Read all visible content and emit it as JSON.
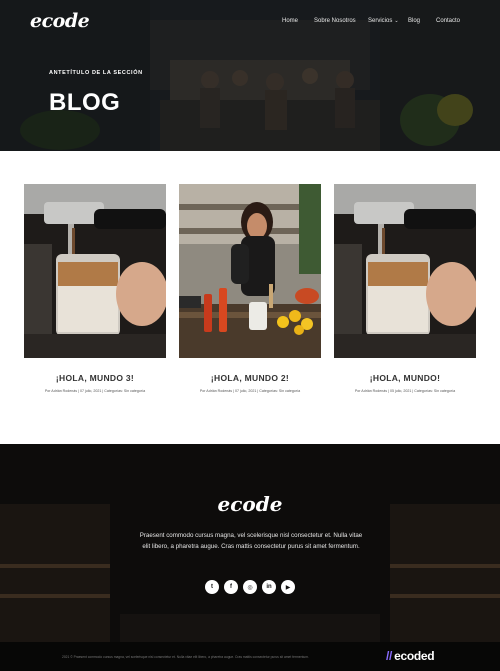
{
  "header": {
    "logo": "ecode",
    "nav": [
      {
        "label": "Home",
        "has_dropdown": false
      },
      {
        "label": "Sobre Nosotros",
        "has_dropdown": false
      },
      {
        "label": "Servicios",
        "has_dropdown": true
      },
      {
        "label": "Blog",
        "has_dropdown": false
      },
      {
        "label": "Contacto",
        "has_dropdown": false
      }
    ]
  },
  "hero": {
    "subtitle": "ANTETÍTULO DE LA SECCIÓN",
    "title": "BLOG"
  },
  "posts": [
    {
      "title": "¡HOLA, MUNDO 3!",
      "meta": "Por Adrián Rodenás | 07 julio, 2021 | Categorías: Sin categoría",
      "image": "espresso-photo"
    },
    {
      "title": "¡HOLA, MUNDO 2!",
      "meta": "Por Adrián Rodenás | 07 julio, 2021 | Categorías: Sin categoría",
      "image": "cooking-woman-photo"
    },
    {
      "title": "¡HOLA, MUNDO!",
      "meta": "Por Adrián Rodenás | 05 julio, 2021 | Categorías: Sin categoría",
      "image": "espresso-photo"
    }
  ],
  "footer": {
    "logo": "ecode",
    "text": "Praesent commodo cursus magna, vel scelerisque nisl consectetur et. Nulla vitae elit libero, a pharetra augue. Cras mattis consectetur purus sit amet fermentum.",
    "socials": [
      {
        "icon": "twitter-icon",
        "glyph": "t"
      },
      {
        "icon": "facebook-icon",
        "glyph": "f"
      },
      {
        "icon": "instagram-icon",
        "glyph": "◎"
      },
      {
        "icon": "linkedin-icon",
        "glyph": "in"
      },
      {
        "icon": "youtube-icon",
        "glyph": "▶"
      }
    ],
    "copyright": "2021 © Praesent commodo cursus magna, vel scelerisque nisl consectetur et. Nulla vitae elit libero, a pharetra augue. Cras mattis consectetur purus sit amet fermentum.",
    "brand_slashes": "//",
    "brand_name": "ecoded"
  },
  "colors": {
    "accent": "#8a6cff",
    "footer_bg": "#0d0c0b",
    "text_dark": "#333333"
  }
}
